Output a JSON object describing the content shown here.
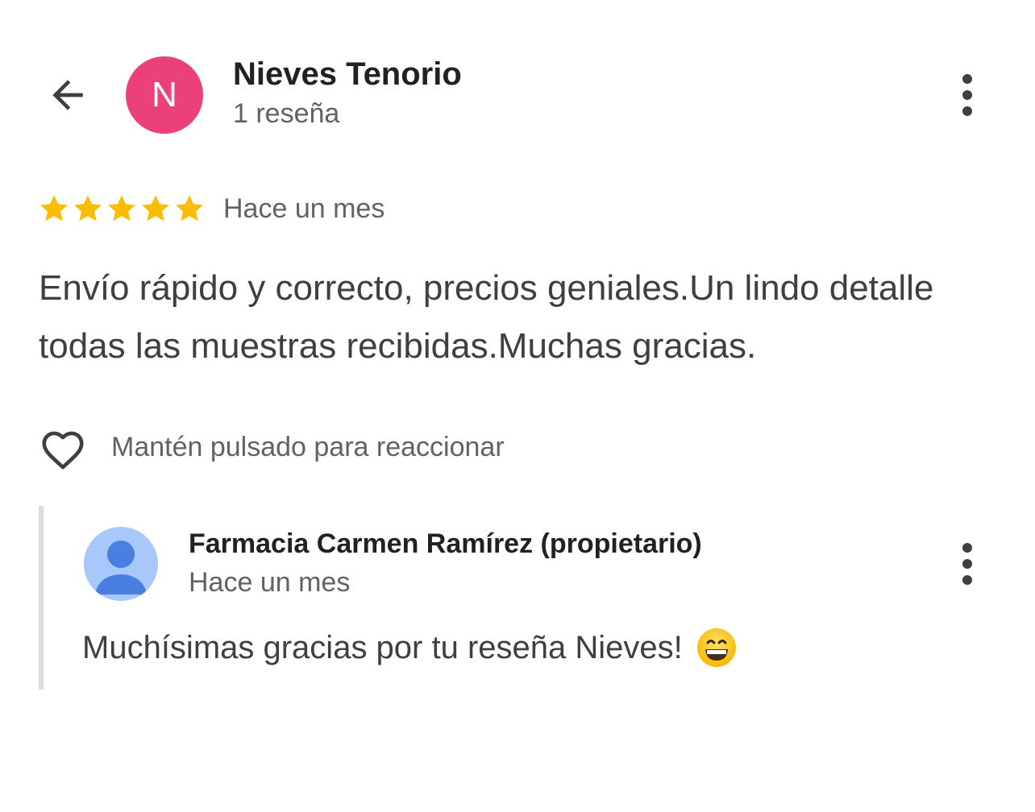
{
  "header": {
    "back_icon": "arrow-left-icon",
    "avatar_initial": "N",
    "avatar_color": "#ec407a",
    "reviewer_name": "Nieves Tenorio",
    "reviewer_review_count": "1 reseña",
    "more_icon": "more-vertical-icon"
  },
  "review": {
    "rating": 5,
    "rating_max": 5,
    "star_color": "#fbbc04",
    "date": "Hace un mes",
    "text": "Envío rápido y correcto, precios geniales.Un lindo detalle todas las muestras recibidas.Muchas gracias."
  },
  "reaction": {
    "icon": "heart-outline-icon",
    "hint": "Mantén pulsado para reaccionar"
  },
  "owner_reply": {
    "avatar_icon": "default-person-avatar-icon",
    "name": "Farmacia Carmen Ramírez (propietario)",
    "date": "Hace un mes",
    "text": "Muchísimas gracias por tu reseña Nieves!",
    "emoji_icon": "grinning-face-emoji-icon",
    "more_icon": "more-vertical-icon"
  }
}
